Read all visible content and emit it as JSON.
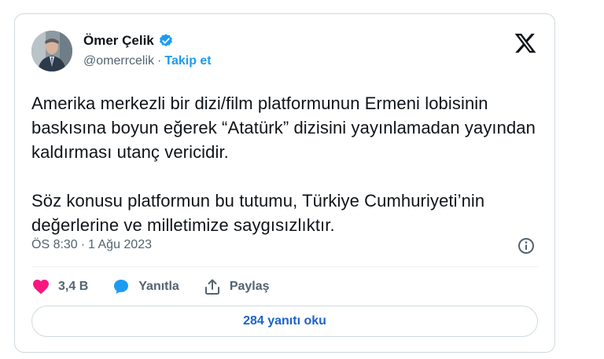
{
  "author": {
    "name": "Ömer Çelik",
    "handle": "@omerrcelik",
    "separator": "·",
    "follow_label": "Takip et"
  },
  "tweet": {
    "text": "Amerika merkezli bir dizi/film platformunun Ermeni lobisinin baskısına boyun eğerek “Atatürk” dizisini yayınlamadan yayından kaldırması utanç vericidir.\n\nSöz konusu platformun bu tutumu, Türkiye Cumhuriyeti’nin değerlerine ve milletimize saygısızlıktır.",
    "time": "ÖS 8:30",
    "separator": "·",
    "date": "1 Ağu 2023"
  },
  "actions": {
    "like_count": "3,4 B",
    "reply_label": "Yanıtla",
    "share_label": "Paylaş"
  },
  "replies_button": "284 yanıtı oku",
  "icons": {
    "verified": "verified-badge-icon",
    "x": "x-logo-icon",
    "info": "info-icon",
    "like": "heart-icon",
    "reply": "reply-icon",
    "share": "share-icon"
  },
  "colors": {
    "accent": "#1d9bf0",
    "heart": "#f91880",
    "muted": "#536471"
  }
}
